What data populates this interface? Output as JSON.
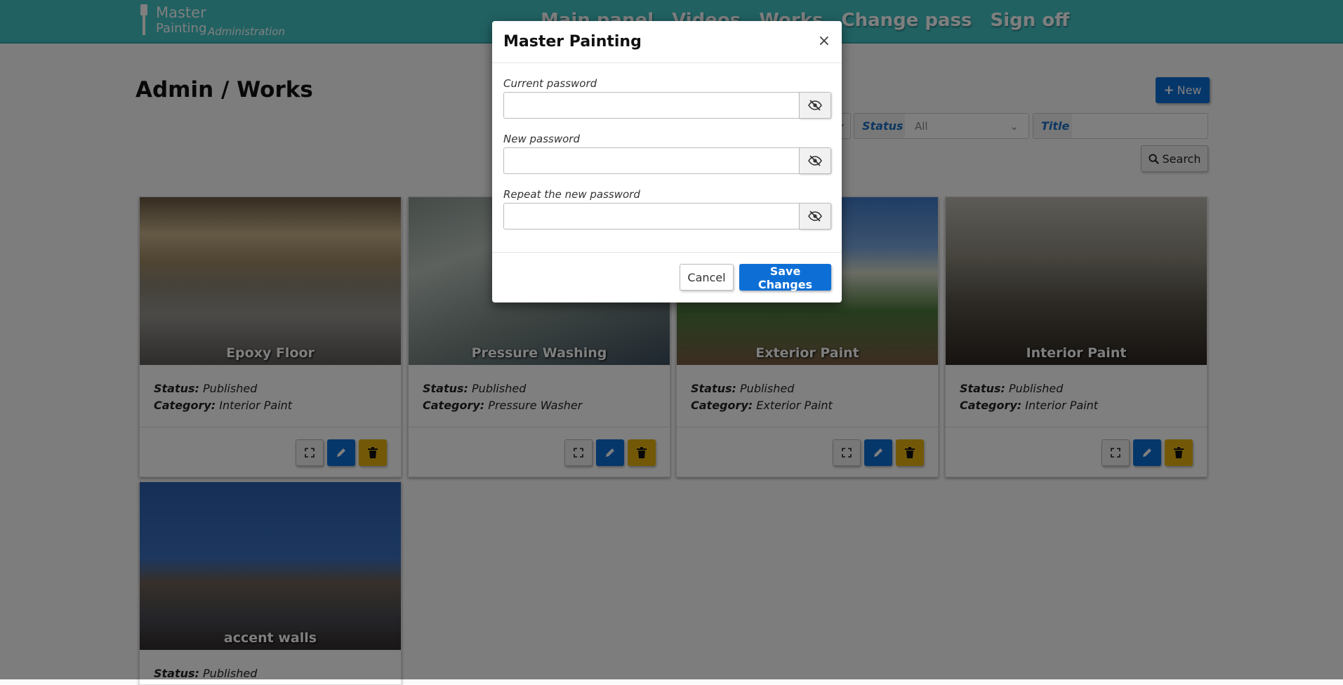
{
  "header": {
    "logo_line1": "Master",
    "logo_line2": "Painting",
    "logo_sub": "Administration",
    "nav": [
      "Main panel",
      "Videos",
      "Works",
      "Change pass",
      "Sign off"
    ]
  },
  "page": {
    "title": "Admin / Works",
    "new_label": "New",
    "search_label": "Search"
  },
  "filters": {
    "status_label": "Status",
    "status_value": "All",
    "title_label": "Title",
    "title_value": ""
  },
  "cards": [
    {
      "title": "Epoxy Floor",
      "status_label": "Status:",
      "status": "Published",
      "category_label": "Category:",
      "category": "Interior Paint"
    },
    {
      "title": "Pressure Washing",
      "status_label": "Status:",
      "status": "Published",
      "category_label": "Category:",
      "category": "Pressure Washer"
    },
    {
      "title": "Exterior Paint",
      "status_label": "Status:",
      "status": "Published",
      "category_label": "Category:",
      "category": "Exterior Paint"
    },
    {
      "title": "Interior Paint",
      "status_label": "Status:",
      "status": "Published",
      "category_label": "Category:",
      "category": "Interior Paint"
    },
    {
      "title": "accent walls",
      "status_label": "Status:",
      "status": "Published"
    }
  ],
  "modal": {
    "title": "Master Painting",
    "close": "×",
    "current_label": "Current password",
    "new_label": "New password",
    "repeat_label": "Repeat the new password",
    "current_value": "",
    "new_value": "",
    "repeat_value": "",
    "cancel_label": "Cancel",
    "save_label": "Save Changes"
  },
  "colors": {
    "header": "#43c2c5",
    "primary": "#0d6fd6",
    "warning": "#e6b30f",
    "filter_label": "#1b6fc3"
  },
  "icons": {
    "new": "plus-icon",
    "search": "search-icon",
    "expand": "expand-icon",
    "edit": "pencil-icon",
    "delete": "trash-icon",
    "password_toggle": "eye-slash-icon"
  }
}
